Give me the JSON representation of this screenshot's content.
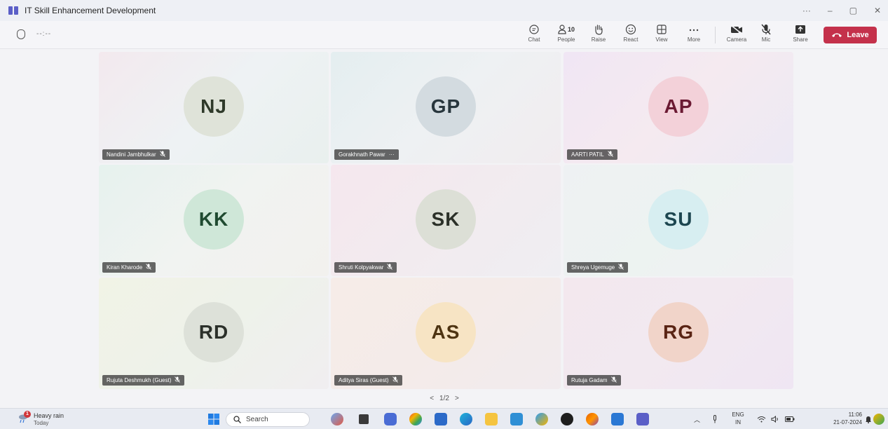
{
  "window": {
    "title": "IT Skill Enhancement Development",
    "controls": [
      "···",
      "–",
      "▢",
      "✕"
    ]
  },
  "toolbar": {
    "timer": "--:--",
    "chat": "Chat",
    "people": "People",
    "people_count": "10",
    "raise": "Raise",
    "react": "React",
    "view": "View",
    "more": "More",
    "camera": "Camera",
    "mic": "Mic",
    "share": "Share",
    "leave": "Leave",
    "leave_color": "#c4314b"
  },
  "participants": [
    {
      "initials": "NJ",
      "name": "Nandini Jambhulkar",
      "status": "muted",
      "avatar_bg": "#dfe3d9",
      "text_color": "#2f3a2a",
      "tile_bg": "linear-gradient(135deg,#f3e9ee 0%,#eef2f4 50%,#e9f0ee 100%)"
    },
    {
      "initials": "GP",
      "name": "Gorakhnath Pawar",
      "status": "more",
      "avatar_bg": "#d3dbe0",
      "text_color": "#28363d",
      "tile_bg": "linear-gradient(135deg,#e4eef0 0%,#eef1f3 50%,#f1ecef 100%)"
    },
    {
      "initials": "AP",
      "name": "AARTI PATIL",
      "status": "muted",
      "avatar_bg": "#f3d1d9",
      "text_color": "#6b1a33",
      "tile_bg": "linear-gradient(135deg,#f0e6f4 0%,#f5eaf0 50%,#ece9f4 100%)"
    },
    {
      "initials": "KK",
      "name": "Kiran Kharode",
      "status": "muted",
      "avatar_bg": "#cfe7d8",
      "text_color": "#1f4a30",
      "tile_bg": "linear-gradient(135deg,#e6f2ee 0%,#f1f3f1 50%,#f2f1ee 100%)"
    },
    {
      "initials": "SK",
      "name": "Shruti Kolpyakwar",
      "status": "muted",
      "avatar_bg": "#dcdfd6",
      "text_color": "#2b3028",
      "tile_bg": "linear-gradient(135deg,#f5e7ee 0%,#f2ebef 50%,#efeef2 100%)"
    },
    {
      "initials": "SU",
      "name": "Shreya Ugemuge",
      "status": "muted",
      "avatar_bg": "#d7eef1",
      "text_color": "#1d4650",
      "tile_bg": "linear-gradient(135deg,#eef1f3 0%,#edf3f1 50%,#f0f0f3 100%)"
    },
    {
      "initials": "RD",
      "name": "Rujuta Deshmukh (Guest)",
      "status": "muted",
      "avatar_bg": "#dde1d9",
      "text_color": "#2b302a",
      "tile_bg": "linear-gradient(135deg,#f1f3e6 0%,#eef2ea 50%,#f0eef0 100%)"
    },
    {
      "initials": "AS",
      "name": "Aditya Siras (Guest)",
      "status": "muted",
      "avatar_bg": "#f7e4c4",
      "text_color": "#4e3412",
      "tile_bg": "linear-gradient(135deg,#f6ece8 0%,#f4ebe9 50%,#f1ebee 100%)"
    },
    {
      "initials": "RG",
      "name": "Rutuja Gadam",
      "status": "muted",
      "avatar_bg": "#f1d4c9",
      "text_color": "#5a2414",
      "tile_bg": "linear-gradient(135deg,#f3e8ee 0%,#f2e9f0 50%,#efe6f3 100%)"
    }
  ],
  "pager": {
    "prev": "<",
    "label": "1/2",
    "next": ">"
  },
  "taskbar": {
    "weather_text": "Heavy rain",
    "weather_sub": "Today",
    "weather_badge": "1",
    "search_placeholder": "Search",
    "lang_line1": "ENG",
    "lang_line2": "IN",
    "time": "11:06",
    "date": "21-07-2024"
  }
}
